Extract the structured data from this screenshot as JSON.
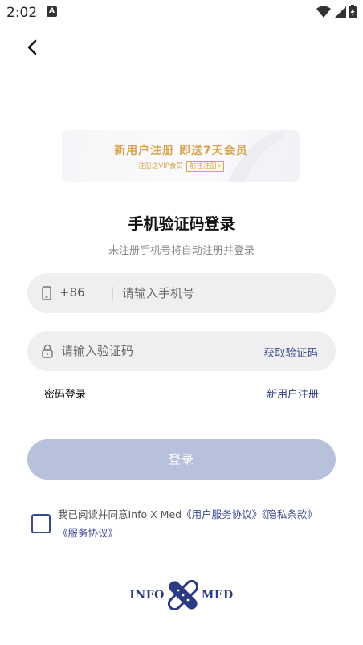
{
  "status_bar": {
    "time": "2:02",
    "notification_badge": "A",
    "icons": [
      "wifi-icon",
      "signal-icon",
      "battery-charging-icon"
    ]
  },
  "nav": {
    "back_icon": "chevron-left-icon"
  },
  "banner": {
    "title": "新用户注册  即送7天会员",
    "subtitle": "注册送VIP会员",
    "cta": "前往注册»"
  },
  "heading": {
    "title": "手机验证码登录",
    "subtitle": "未注册手机号将自动注册并登录"
  },
  "phone_field": {
    "icon": "phone-icon",
    "prefix": "+86",
    "placeholder": "请输入手机号",
    "value": ""
  },
  "code_field": {
    "icon": "lock-icon",
    "placeholder": "请输入验证码",
    "value": "",
    "get_code_label": "获取验证码"
  },
  "links": {
    "password_login": "密码登录",
    "new_user_register": "新用户注册"
  },
  "login_button": {
    "label": "登录"
  },
  "agreement": {
    "checked": false,
    "prefix": "我已阅读并同意Info X Med",
    "link1": "《用户服务协议》",
    "link2": "《隐私条款》",
    "link3": "《服务协议》"
  },
  "logo": {
    "left_text": "INFO",
    "right_text": "MED"
  },
  "colors": {
    "accent": "#3a4894",
    "button_disabled": "#b8c1dc",
    "banner_gold": "#d8a34c",
    "field_bg": "#efeff1"
  }
}
